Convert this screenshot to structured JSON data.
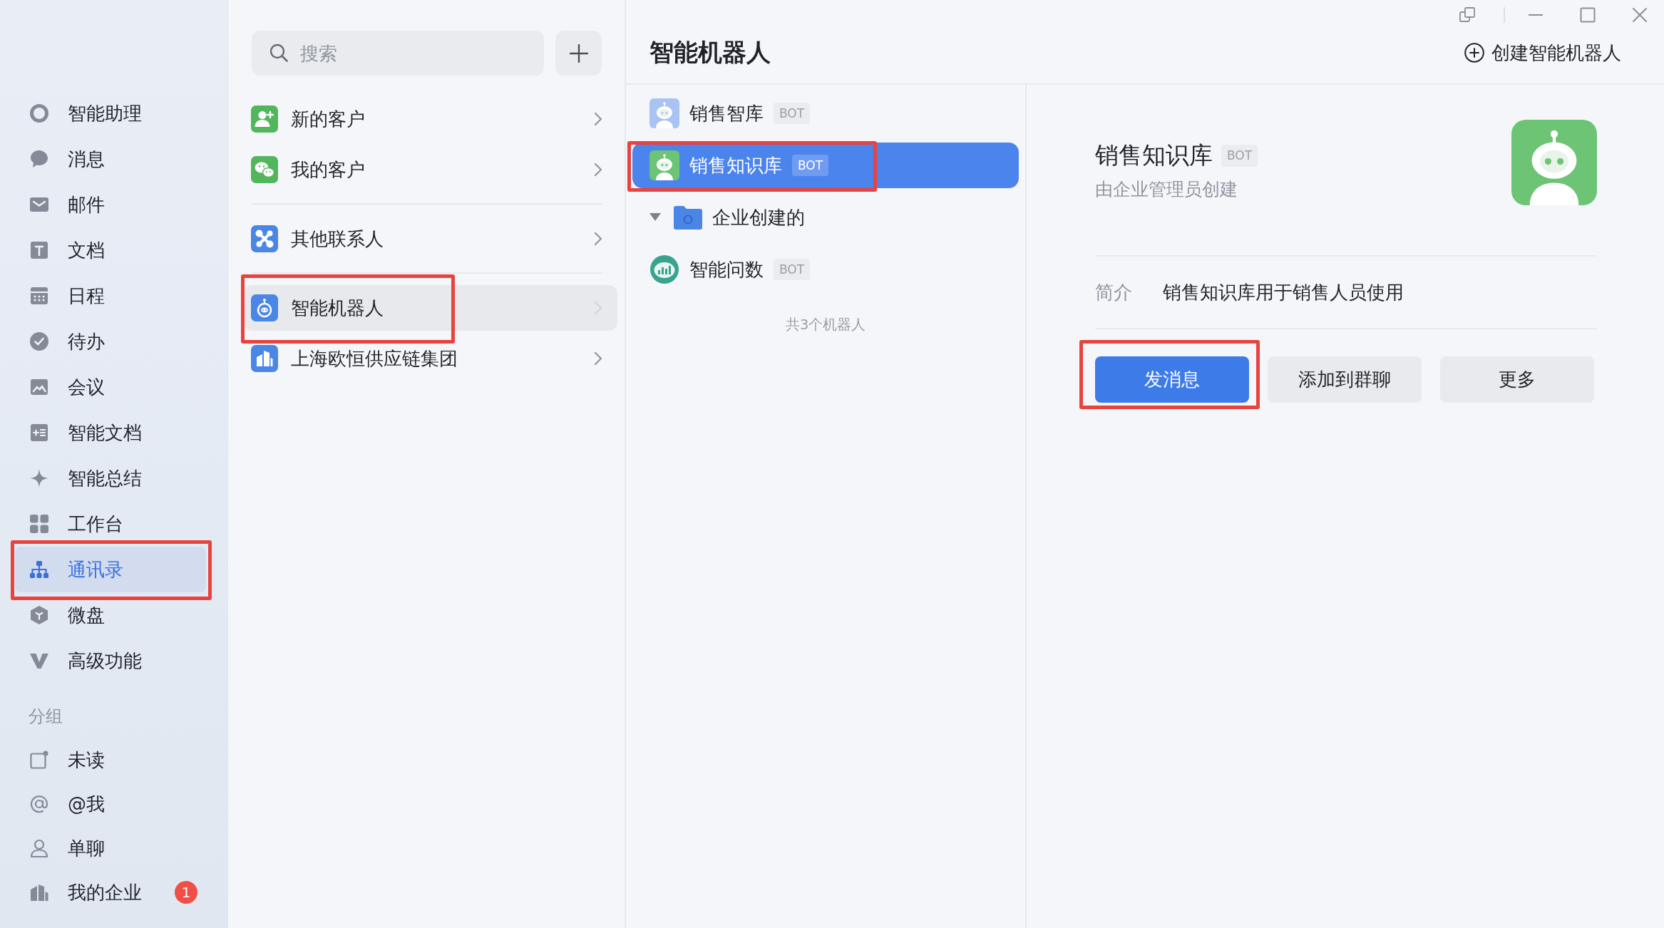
{
  "sidebar": {
    "nav_items": [
      {
        "label": "智能助理",
        "selected": false,
        "annotated": false
      },
      {
        "label": "消息",
        "selected": false,
        "annotated": false
      },
      {
        "label": "邮件",
        "selected": false,
        "annotated": false
      },
      {
        "label": "文档",
        "selected": false,
        "annotated": false
      },
      {
        "label": "日程",
        "selected": false,
        "annotated": false
      },
      {
        "label": "待办",
        "selected": false,
        "annotated": false
      },
      {
        "label": "会议",
        "selected": false,
        "annotated": false
      },
      {
        "label": "智能文档",
        "selected": false,
        "annotated": false
      },
      {
        "label": "智能总结",
        "selected": false,
        "annotated": false
      },
      {
        "label": "工作台",
        "selected": false,
        "annotated": false
      },
      {
        "label": "通讯录",
        "selected": true,
        "annotated": true
      },
      {
        "label": "微盘",
        "selected": false,
        "annotated": false
      },
      {
        "label": "高级功能",
        "selected": false,
        "annotated": false
      }
    ],
    "group_heading": "分组",
    "group_items": [
      {
        "label": "未读",
        "selected": false
      },
      {
        "label": "@我",
        "selected": false
      },
      {
        "label": "单聊",
        "selected": false
      },
      {
        "label": "我的企业",
        "selected": false,
        "badge": "1"
      }
    ]
  },
  "contacts": {
    "search": {
      "placeholder": "搜索"
    },
    "sections": [
      {
        "items": [
          {
            "label": "新的客户",
            "selected": false,
            "annotated": false
          },
          {
            "label": "我的客户",
            "selected": false,
            "annotated": false
          }
        ]
      },
      {
        "items": [
          {
            "label": "其他联系人",
            "selected": false,
            "annotated": false
          }
        ]
      },
      {
        "items": [
          {
            "label": "智能机器人",
            "selected": true,
            "annotated": true
          },
          {
            "label": "上海欧恒供应链集团",
            "selected": false,
            "annotated": false
          }
        ]
      }
    ]
  },
  "robots": {
    "title": "智能机器人",
    "create_button": "创建智能机器人",
    "items": [
      {
        "kind": "robot",
        "name": "销售智库",
        "tag": "BOT",
        "color": "#a9c3f3",
        "selected": false,
        "annotated": false
      },
      {
        "kind": "robot",
        "name": "销售知识库",
        "tag": "BOT",
        "color": "#6cc474",
        "selected": true,
        "annotated": true
      },
      {
        "kind": "group",
        "name": "企业创建的",
        "expanded": true,
        "selected": false,
        "annotated": false,
        "children": [
          {
            "kind": "analytics",
            "name": "智能问数",
            "tag": "BOT",
            "selected": false,
            "annotated": false
          }
        ]
      }
    ],
    "count": "共3个机器人"
  },
  "detail": {
    "name": "销售知识库",
    "tag": "BOT",
    "subtitle": "由企业管理员创建",
    "intro_label": "简介",
    "intro": "销售知识库用于销售人员使用",
    "buttons": [
      {
        "label": "发消息",
        "kind": "primary",
        "annotated": true
      },
      {
        "label": "添加到群聊",
        "kind": "secondary",
        "annotated": false
      },
      {
        "label": "更多",
        "kind": "secondary",
        "annotated": false
      }
    ]
  }
}
